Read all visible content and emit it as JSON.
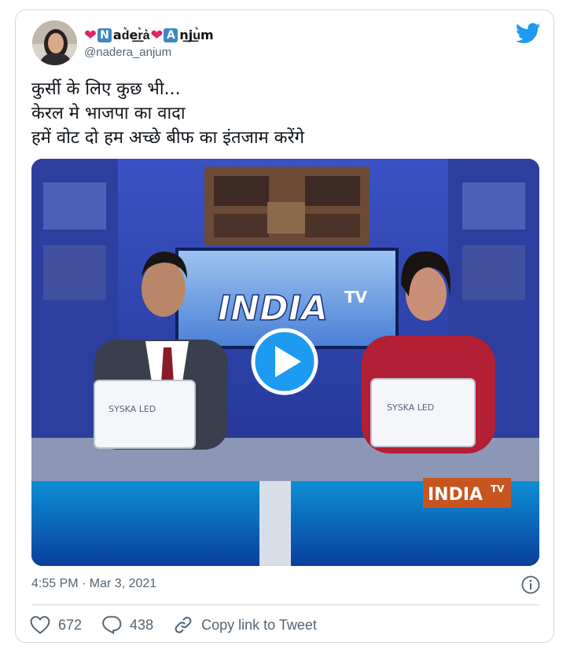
{
  "author": {
    "name_parts": {
      "heart": "❤",
      "n": "N",
      "rest1": "ad͛e͟r͛a͛",
      "a": "A",
      "rest2": "n͟j͟u͛m"
    },
    "handle": "@nadera_anjum"
  },
  "tweet": {
    "lines": [
      "कुर्सी के लिए कुछ भी...",
      "केरल मे भाजपा का वादा",
      "हमें वोट दो हम अच्छे बीफ का इंतजाम करेंगे"
    ]
  },
  "video": {
    "brand_top": "INDIA",
    "brand_top_tv": "TV",
    "laptop_left": "SYSKA LED",
    "laptop_right": "SYSKA LED",
    "corner_logo": "INDIA",
    "corner_logo_tv": "TV"
  },
  "meta": {
    "timestamp": "4:55 PM · Mar 3, 2021"
  },
  "actions": {
    "likes": "672",
    "replies": "438",
    "copy_link": "Copy link to Tweet"
  },
  "colors": {
    "brand_blue": "#1d9bf0",
    "heart_red": "#e0245e",
    "secondary_text": "#536471"
  },
  "icons": [
    "twitter-bird-icon",
    "play-icon",
    "info-icon",
    "heart-icon",
    "reply-icon",
    "link-icon"
  ]
}
